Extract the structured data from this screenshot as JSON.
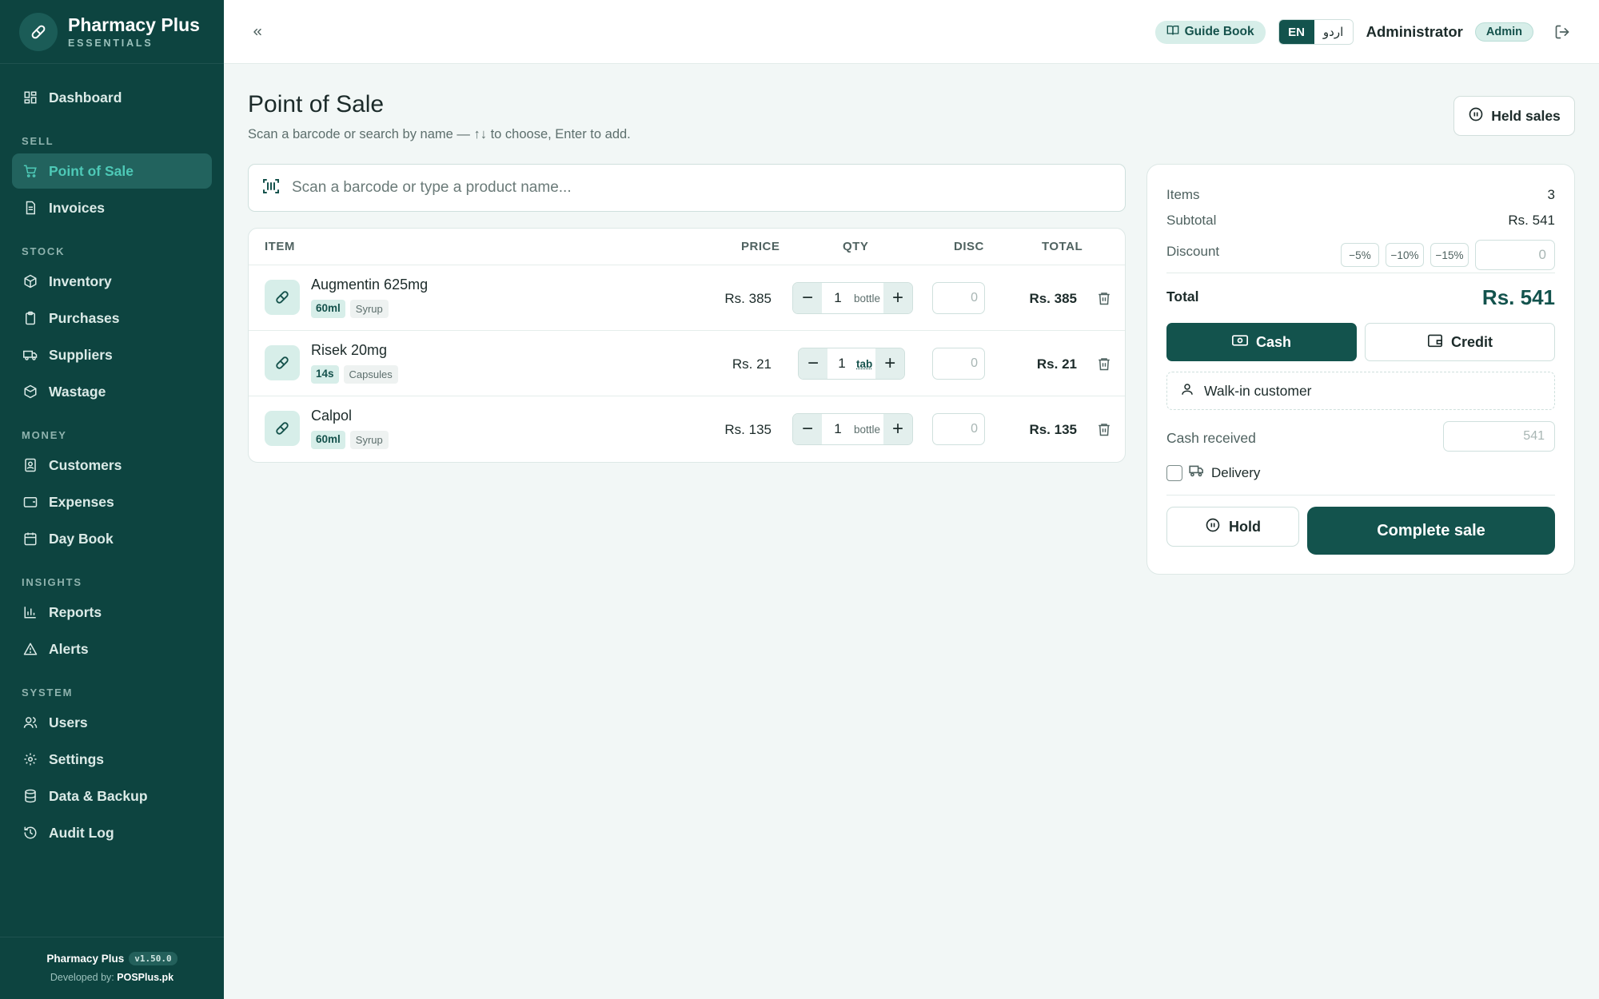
{
  "brand": {
    "name": "Pharmacy Plus",
    "subtitle": "ESSENTIALS"
  },
  "sidebar": {
    "top_item": {
      "label": "Dashboard",
      "icon": "dashboard-icon"
    },
    "sections": [
      {
        "title": "SELL",
        "items": [
          {
            "label": "Point of Sale",
            "icon": "cart-icon",
            "active": true
          },
          {
            "label": "Invoices",
            "icon": "invoice-icon"
          }
        ]
      },
      {
        "title": "STOCK",
        "items": [
          {
            "label": "Inventory",
            "icon": "box-icon"
          },
          {
            "label": "Purchases",
            "icon": "clipboard-icon"
          },
          {
            "label": "Suppliers",
            "icon": "truck-icon"
          },
          {
            "label": "Wastage",
            "icon": "box-x-icon"
          }
        ]
      },
      {
        "title": "MONEY",
        "items": [
          {
            "label": "Customers",
            "icon": "customer-icon"
          },
          {
            "label": "Expenses",
            "icon": "wallet-icon"
          },
          {
            "label": "Day Book",
            "icon": "calendar-icon"
          }
        ]
      },
      {
        "title": "INSIGHTS",
        "items": [
          {
            "label": "Reports",
            "icon": "bar-chart-icon"
          },
          {
            "label": "Alerts",
            "icon": "warning-icon"
          }
        ]
      },
      {
        "title": "SYSTEM",
        "items": [
          {
            "label": "Users",
            "icon": "users-icon"
          },
          {
            "label": "Settings",
            "icon": "gear-icon"
          },
          {
            "label": "Data & Backup",
            "icon": "database-icon"
          },
          {
            "label": "Audit Log",
            "icon": "history-icon"
          }
        ]
      }
    ],
    "footer": {
      "app": "Pharmacy Plus",
      "version": "v1.50.0",
      "dev_prefix": "Developed by:",
      "dev_name": "POSPlus.pk"
    }
  },
  "topbar": {
    "guide_label": "Guide Book",
    "lang_en": "EN",
    "lang_ur": "اردو",
    "user_name": "Administrator",
    "role": "Admin"
  },
  "page": {
    "title": "Point of Sale",
    "subtitle": "Scan a barcode or search by name — ↑↓ to choose, Enter to add.",
    "held_label": "Held sales"
  },
  "search": {
    "placeholder": "Scan a barcode or type a product name..."
  },
  "cart": {
    "headers": {
      "item": "ITEM",
      "price": "PRICE",
      "qty": "QTY",
      "disc": "DISC",
      "total": "TOTAL"
    },
    "rows": [
      {
        "name": "Augmentin 625mg",
        "size": "60ml",
        "form": "Syrup",
        "price": "Rs. 385",
        "qty": "1",
        "unit": "bottle",
        "disc": "0",
        "total": "Rs. 385"
      },
      {
        "name": "Risek 20mg",
        "size": "14s",
        "form": "Capsules",
        "price": "Rs. 21",
        "qty": "1",
        "unit": "tab",
        "disc": "0",
        "total": "Rs. 21"
      },
      {
        "name": "Calpol",
        "size": "60ml",
        "form": "Syrup",
        "price": "Rs. 135",
        "qty": "1",
        "unit": "bottle",
        "disc": "0",
        "total": "Rs. 135"
      }
    ]
  },
  "summary": {
    "items_label": "Items",
    "items_value": "3",
    "subtotal_label": "Subtotal",
    "subtotal_value": "Rs. 541",
    "discount_label": "Discount",
    "discount_chips": [
      "−5%",
      "−10%",
      "−15%"
    ],
    "discount_value": "0",
    "total_label": "Total",
    "total_value": "Rs. 541",
    "cash_label": "Cash",
    "credit_label": "Credit",
    "customer_label": "Walk-in customer",
    "cash_received_label": "Cash received",
    "cash_received_value": "541",
    "delivery_label": "Delivery",
    "hold_label": "Hold",
    "complete_label": "Complete sale"
  },
  "colors": {
    "sidebar_bg": "#0d4440",
    "accent": "#13534d",
    "active_text": "#4ec9b7",
    "page_bg": "#f2f7f6"
  }
}
